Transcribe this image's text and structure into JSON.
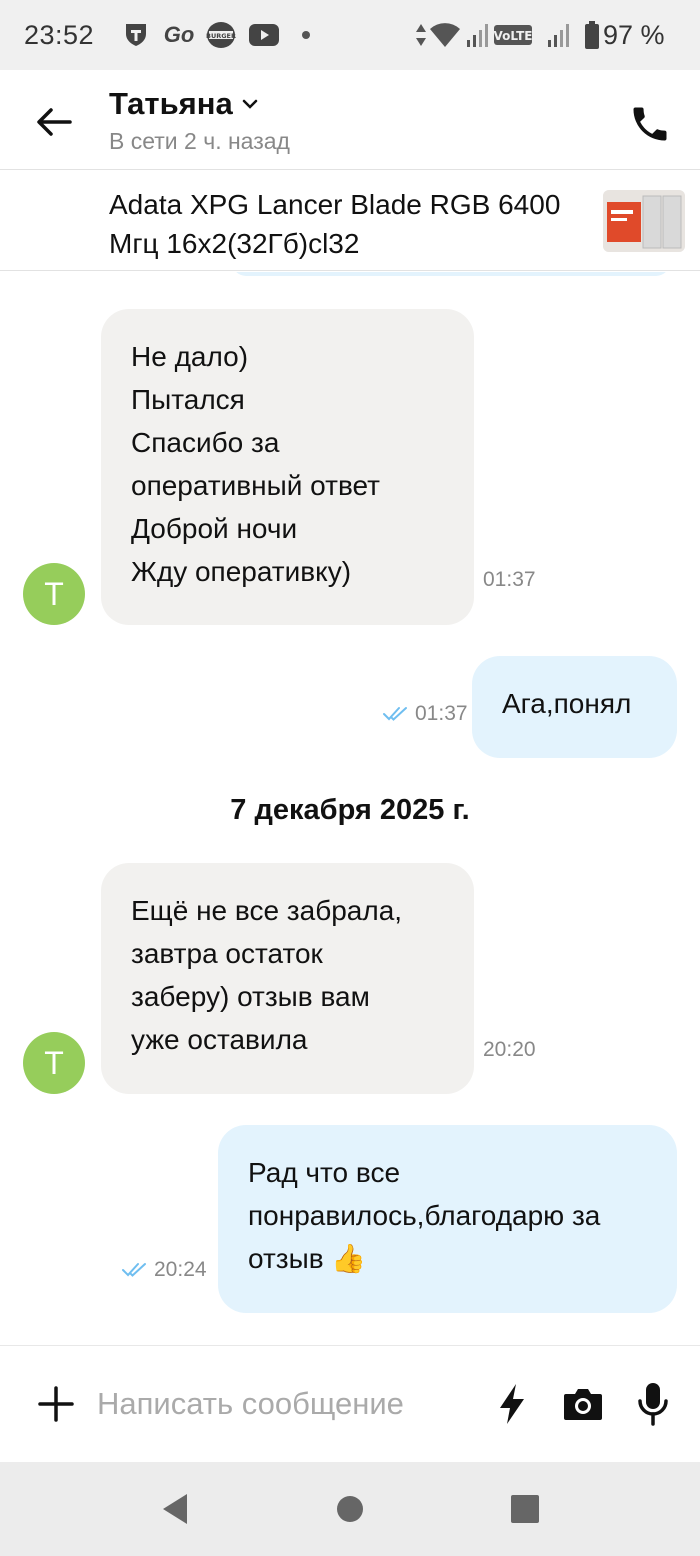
{
  "status_bar": {
    "time": "23:52",
    "battery": "97 %",
    "icons": [
      "tinkoff-icon",
      "go-icon",
      "burger-king-icon",
      "youtube-icon",
      "dot-icon",
      "data-arrows-icon",
      "wifi-icon",
      "signal-1-icon",
      "volte-icon",
      "signal-2-icon",
      "battery-icon"
    ]
  },
  "header": {
    "contact_name": "Татьяна",
    "status": "В сети 2 ч. назад"
  },
  "listing": {
    "title": "Adata XPG Lancer Blade RGB 6400 Мгц 16x2(32Гб)cl32"
  },
  "messages": [
    {
      "direction": "in",
      "avatar": "Т",
      "lines": [
        "Не дало)",
        "Пытался",
        "Спасибо за",
        "оперативный ответ",
        "Доброй ночи",
        "Жду оперативку)"
      ],
      "time": "01:37"
    },
    {
      "direction": "out",
      "lines": [
        "Ага,понял"
      ],
      "time": "01:37",
      "status": "read"
    },
    {
      "date": "7 декабря 2025 г."
    },
    {
      "direction": "in",
      "avatar": "Т",
      "lines": [
        "Ещё не все забрала,",
        "завтра остаток",
        "заберу) отзыв вам",
        "уже оставила"
      ],
      "time": "20:20"
    },
    {
      "direction": "out",
      "lines": [
        "Рад что все",
        "понравилось,благодарю за",
        "отзыв 👍"
      ],
      "time": "20:24",
      "status": "read"
    }
  ],
  "input": {
    "placeholder": "Написать сообщение"
  },
  "colors": {
    "incoming_bubble": "#f2f1ef",
    "outgoing_bubble": "#e3f3fd",
    "avatar": "#96cd5b",
    "read_check": "#6fbef0"
  }
}
